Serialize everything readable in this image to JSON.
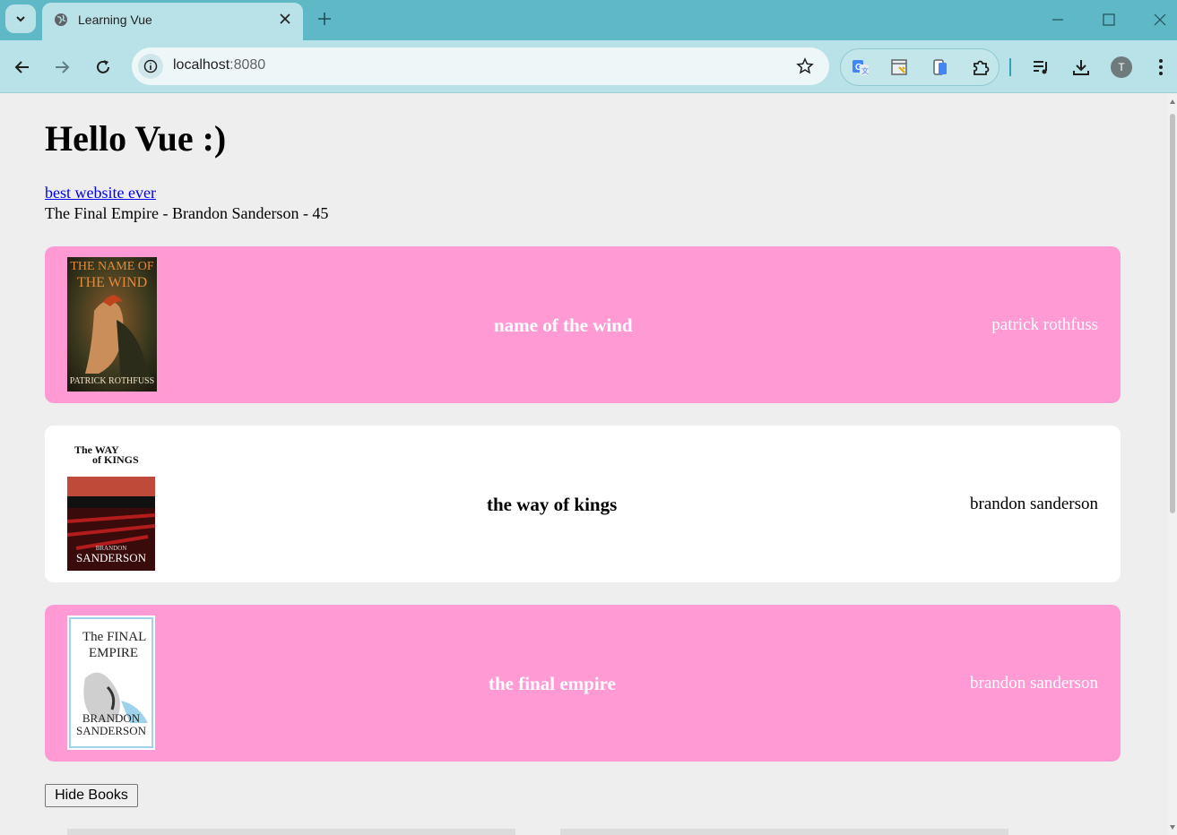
{
  "browser": {
    "tab_title": "Learning Vue",
    "url_host": "localhost",
    "url_port": ":8080",
    "avatar_letter": "T",
    "theme_color": "#5fb8c5"
  },
  "page": {
    "heading": "Hello Vue :)",
    "link_text": "best website ever",
    "summary": "The Final Empire - Brandon Sanderson - 45",
    "hide_button": "Hide Books",
    "fav_color": "#ff9ad5",
    "books": [
      {
        "title": "name of the wind",
        "author": "patrick rothfuss",
        "is_fav": true,
        "cover": {
          "line1": "THE NAME OF",
          "line2": "THE WIND",
          "author": "PATRICK ROTHFUSS"
        }
      },
      {
        "title": "the way of kings",
        "author": "brandon sanderson",
        "is_fav": false,
        "cover": {
          "line1": "The WAY",
          "line2": "of KINGS",
          "author": "BRANDON",
          "author2": "SANDERSON"
        }
      },
      {
        "title": "the final empire",
        "author": "brandon sanderson",
        "is_fav": true,
        "cover": {
          "line1": "The FINAL",
          "line2": "EMPIRE",
          "author": "BRANDON",
          "author2": "SANDERSON"
        }
      }
    ]
  }
}
